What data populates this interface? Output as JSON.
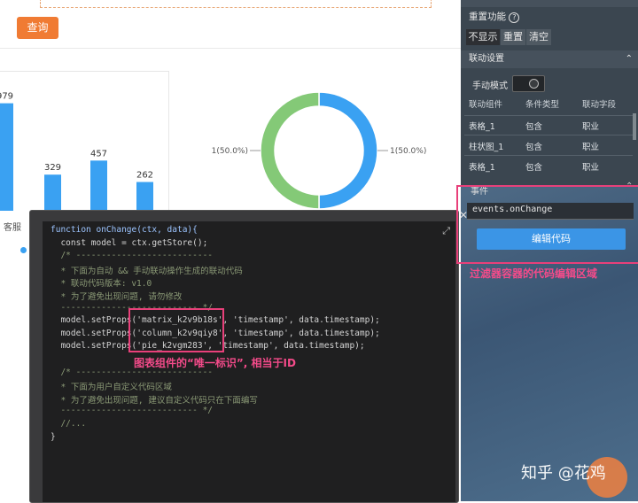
{
  "canvas": {
    "query_label": "查询"
  },
  "colors": {
    "bar": "#3aa1f2",
    "pie_a": "#3aa1f2",
    "pie_b": "#84c977",
    "accent_pink": "#e8407a",
    "query_orange": "#f07b33"
  },
  "chart_data": [
    {
      "type": "bar",
      "categories": [
        "客服",
        "",
        "",
        ""
      ],
      "values": [
        979,
        329,
        457,
        262
      ],
      "data_labels": [
        "979",
        "329",
        "457",
        "262"
      ],
      "ylim": [
        0,
        1000
      ],
      "grid": false
    },
    {
      "type": "pie",
      "donut": true,
      "labels": [
        "1(50.0%)",
        "1(50.0%)"
      ],
      "values": [
        1,
        1
      ]
    }
  ],
  "code": {
    "lines": [
      "function onChange(ctx, data){",
      "  const model = ctx.getStore();",
      "  /* ---------------------------",
      "  * 下面为自动 && 手动联动操作生成的联动代码",
      "  * 联动代码版本: v1.0",
      "  * 为了避免出现问题, 请勿修改",
      "  --------------------------- */",
      "  model.setProps('matrix_k2v9b18s', 'timestamp', data.timestamp);",
      "  model.setProps('column_k2v9qiy8', 'timestamp', data.timestamp);",
      "  model.setProps('pie_k2vgm283', 'timestamp', data.timestamp);",
      "",
      "  /* ---------------------------",
      "  * 下面为用户自定义代码区域",
      "  * 为了避免出现问题, 建议自定义代码只在下面编写",
      "  --------------------------- */",
      "  //...",
      "}"
    ],
    "annotation": "图表组件的“唯一标识”, 相当于ID"
  },
  "panel": {
    "reset_title": "重置功能",
    "segments": [
      "不显示",
      "重置",
      "清空"
    ],
    "linkage_title": "联动设置",
    "manual_mode_label": "手动模式",
    "table_headers": [
      "联动组件",
      "条件类型",
      "联动字段"
    ],
    "table_rows": [
      [
        "表格_1",
        "包含",
        "职业"
      ],
      [
        "柱状图_1",
        "包含",
        "职业"
      ],
      [
        "表格_1",
        "包含",
        "职业"
      ]
    ],
    "events_title": "事件",
    "events_value": "events.onChange",
    "edit_code_label": "编辑代码",
    "annotation": "过滤器容器的代码编辑区域"
  },
  "watermark": "知乎 @花鸡"
}
